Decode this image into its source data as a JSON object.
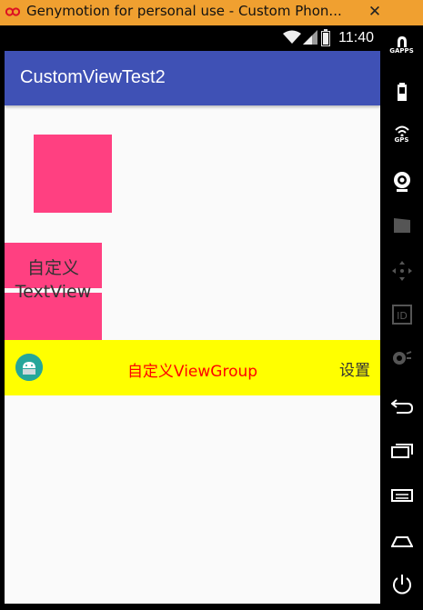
{
  "window": {
    "title": "Genymotion for personal use - Custom Phon...",
    "close_icon": "close-icon"
  },
  "statusbar": {
    "time": "11:40",
    "icons": [
      "wifi-icon",
      "signal-icon",
      "battery-icon"
    ]
  },
  "appbar": {
    "title": "CustomViewTest2"
  },
  "content": {
    "custom_textview_text": "自定义TextView",
    "viewgroup": {
      "label": "自定义ViewGroup",
      "settings": "设置",
      "icon": "android-icon"
    }
  },
  "sidepanel": {
    "gapps_label": "GAPPS",
    "gps_label": "GPS",
    "id_label": "ID",
    "buttons": [
      "gapps-icon",
      "battery-icon",
      "gps-icon",
      "camera-icon",
      "video-icon",
      "dpad-icon",
      "id-icon",
      "volume-icon",
      "back-icon",
      "recent-apps-icon",
      "menu-icon",
      "home-icon",
      "power-icon"
    ]
  },
  "colors": {
    "titlebar": "#f0a030",
    "appbar": "#3f51b5",
    "accent_pink": "#ff4081",
    "viewgroup_bg": "#ffff00",
    "viewgroup_text": "#ff0000"
  }
}
